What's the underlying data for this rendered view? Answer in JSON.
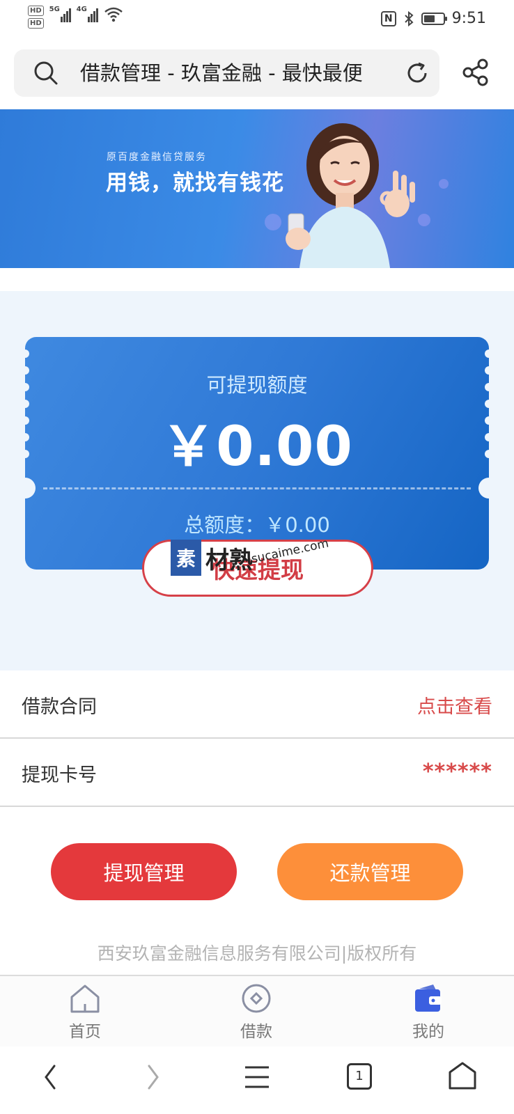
{
  "status_bar": {
    "hd1": "HD",
    "hd2": "HD",
    "net1": "5G",
    "net2": "4G",
    "nfc": "N",
    "battery_level": 0.6,
    "time": "9:51"
  },
  "address_bar": {
    "title": "借款管理 - 玖富金融 - 最快最便"
  },
  "banner": {
    "subtitle": "原百度金融信贷服务",
    "title": "用钱，就找有钱花"
  },
  "card": {
    "label": "可提现额度",
    "amount": "￥0.00",
    "total": "总额度：￥0.00",
    "quick_button": "快速提现"
  },
  "watermark": {
    "logo_char": "素",
    "text": "材熟",
    "url": "sucaime.com"
  },
  "rows": [
    {
      "label": "借款合同",
      "value": "点击查看"
    },
    {
      "label": "提现卡号",
      "value": "******"
    }
  ],
  "actions": {
    "withdraw": "提现管理",
    "repay": "还款管理"
  },
  "copyright": "西安玖富金融信息服务有限公司|版权所有",
  "tabs": [
    {
      "label": "首页",
      "icon": "home-icon"
    },
    {
      "label": "借款",
      "icon": "loan-icon"
    },
    {
      "label": "我的",
      "icon": "wallet-icon"
    }
  ],
  "browser": {
    "tab_count": "1"
  },
  "colors": {
    "primary_blue": "#2f79d6",
    "red": "#e4393c",
    "orange": "#fd8f3a",
    "link_red": "#d84a4a"
  }
}
